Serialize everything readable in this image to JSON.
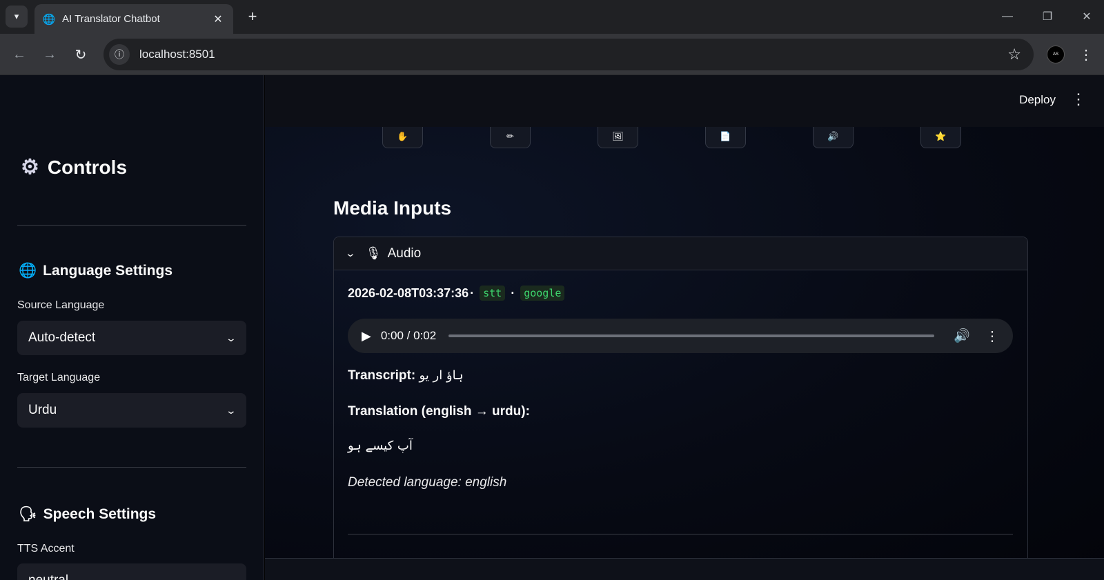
{
  "browser": {
    "tab_title": "AI Translator Chatbot",
    "url": "localhost:8501",
    "profile_initials": "AS"
  },
  "header": {
    "deploy_label": "Deploy"
  },
  "sidebar": {
    "title": "Controls",
    "language_settings": {
      "heading": "Language Settings",
      "source_label": "Source Language",
      "source_value": "Auto-detect",
      "target_label": "Target Language",
      "target_value": "Urdu"
    },
    "speech_settings": {
      "heading": "Speech Settings",
      "tts_accent_label": "TTS Accent",
      "tts_accent_value": "neutral"
    }
  },
  "main": {
    "media_heading": "Media Inputs",
    "audio_expander": {
      "label": "Audio",
      "expanded": true,
      "timestamp": "2026-02-08T03:37:36",
      "mode_badge": "stt",
      "engine_badge": "google",
      "player": {
        "time": "0:00 / 0:02",
        "progress": 0.0
      },
      "transcript_label": "Transcript:",
      "transcript_text": "ہاؤ ار یو",
      "translation_label": "Translation (english → urdu):",
      "translation_text": "آپ کیسے ہو",
      "detected_language": "Detected language: english"
    }
  },
  "colors": {
    "accent_green": "#3dd56d",
    "sidebar_bg": "#0b0e17",
    "main_bg": "#070a14"
  }
}
